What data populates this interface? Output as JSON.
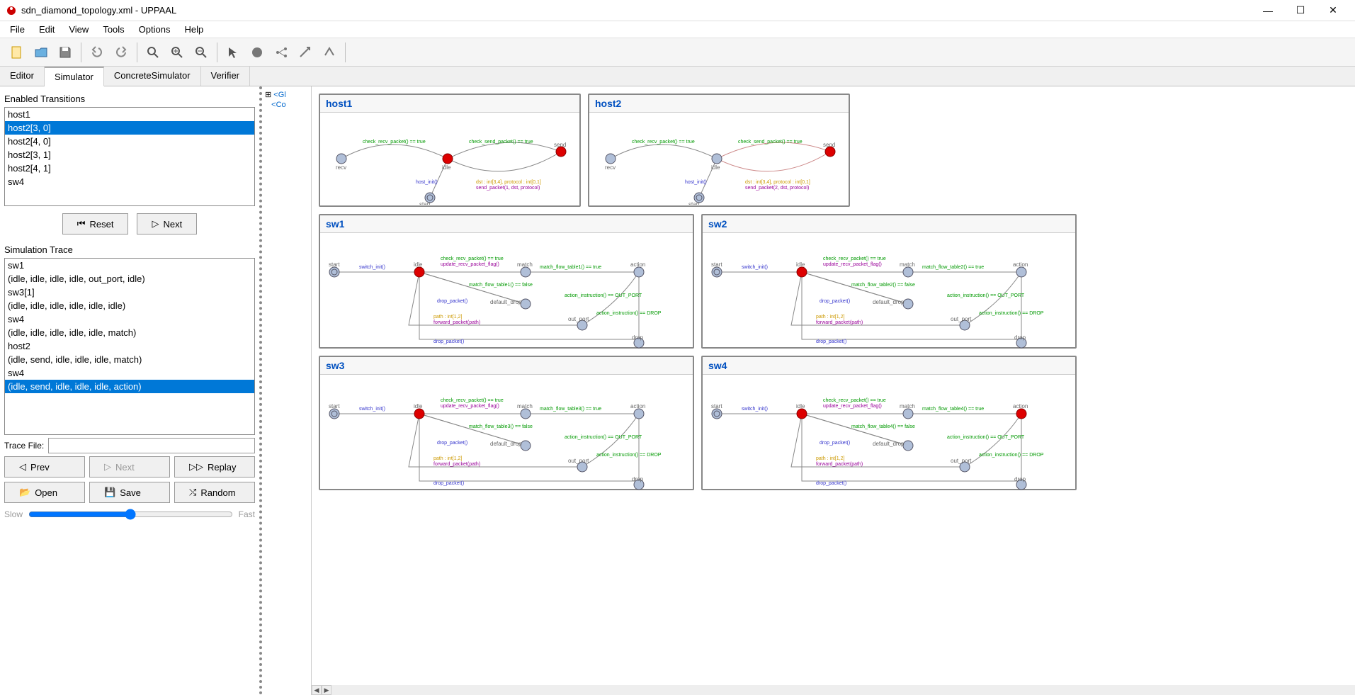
{
  "window": {
    "title": "sdn_diamond_topology.xml - UPPAAL"
  },
  "menu": {
    "file": "File",
    "edit": "Edit",
    "view": "View",
    "tools": "Tools",
    "options": "Options",
    "help": "Help"
  },
  "tabs": {
    "editor": "Editor",
    "simulator": "Simulator",
    "concrete": "ConcreteSimulator",
    "verifier": "Verifier"
  },
  "enabled_transitions": {
    "label": "Enabled Transitions",
    "items": [
      "host1",
      "host2[3, 0]",
      "host2[4, 0]",
      "host2[3, 1]",
      "host2[4, 1]",
      "sw4"
    ],
    "selected_index": 1,
    "reset": "Reset",
    "next": "Next"
  },
  "simulation_trace": {
    "label": "Simulation Trace",
    "items": [
      "sw1",
      "(idle, idle, idle, idle, out_port, idle)",
      "sw3[1]",
      "(idle, idle, idle, idle, idle, idle)",
      "sw4",
      "(idle, idle, idle, idle, idle, match)",
      "host2",
      "(idle, send, idle, idle, idle, match)",
      "sw4",
      "(idle, send, idle, idle, idle, action)"
    ],
    "selected_index": 9
  },
  "trace_file_label": "Trace File:",
  "trace_buttons": {
    "prev": "Prev",
    "next": "Next",
    "replay": "Replay",
    "open": "Open",
    "save": "Save",
    "random": "Random"
  },
  "slider": {
    "slow": "Slow",
    "fast": "Fast"
  },
  "tree": {
    "gl": "<Gl",
    "co": "<Co"
  },
  "diagrams": {
    "host1": "host1",
    "host2": "host2",
    "sw1": "sw1",
    "sw2": "sw2",
    "sw3": "sw3",
    "sw4": "sw4"
  },
  "labels": {
    "recv": "recv",
    "idle": "idle",
    "send": "send",
    "start": "start",
    "match": "match",
    "action": "action",
    "out_port": "out_port",
    "drop": "drop",
    "default_drop": "default_drop",
    "check_recv": "check_recv_packet() == true",
    "check_send": "check_send_packet() == true",
    "host_init": "host_init()",
    "switch_init": "switch_init()",
    "match_flow1t": "match_flow_table1() == true",
    "match_flow1f": "match_flow_table1() == false",
    "match_flow2t": "match_flow_table2() == true",
    "match_flow2f": "match_flow_table2() == false",
    "match_flow3t": "match_flow_table3() == true",
    "match_flow3f": "match_flow_table3() == false",
    "match_flow4t": "match_flow_table4() == true",
    "match_flow4f": "match_flow_table4() == false",
    "update_recv": "update_recv_packet_flag()",
    "drop_packet": "drop_packet()",
    "forward_packet": "forward_packet(path)",
    "path_int": "path : int[1,2]",
    "action_out": "action_instruction() == OUT_PORT",
    "action_drop": "action_instruction() == DROP",
    "dst_int": "dst : int[3,4], protocol : int[0,1]",
    "send_packet1": "send_packet(1, dst, protocol)",
    "send_packet2": "send_packet(2, dst, protocol)"
  }
}
